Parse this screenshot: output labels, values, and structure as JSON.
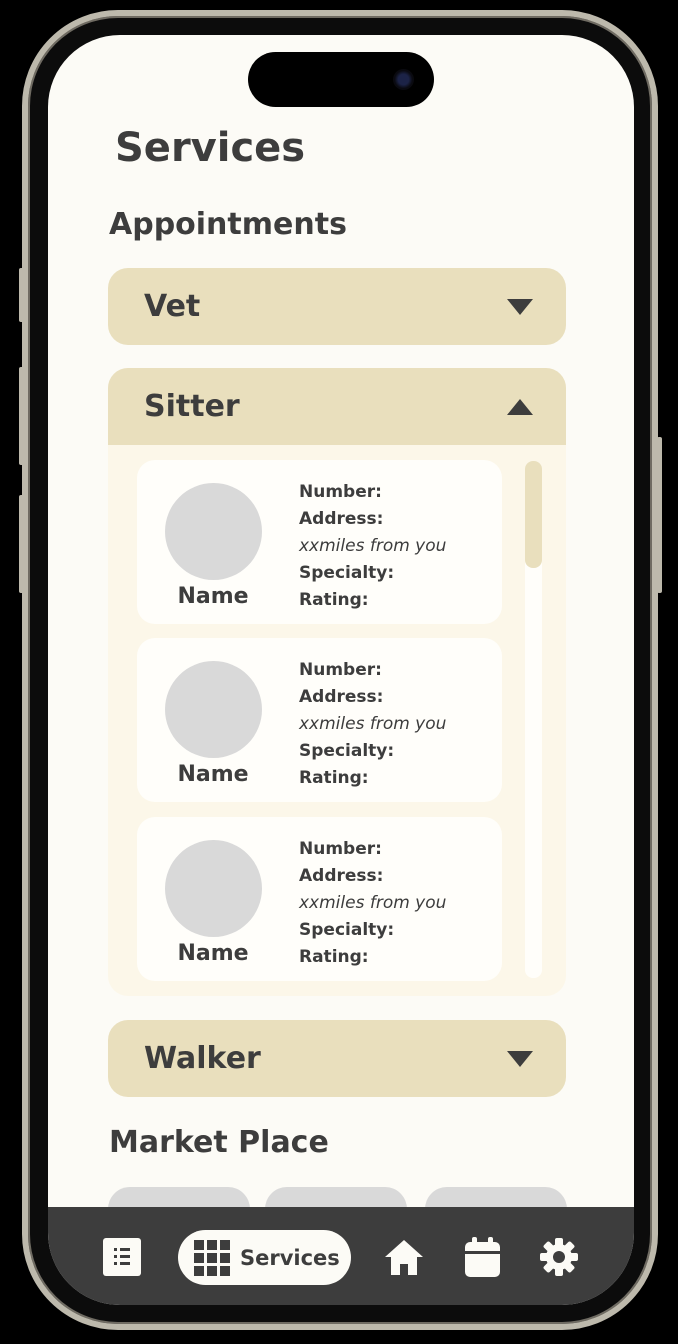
{
  "screen": {
    "title": "Services"
  },
  "appointments": {
    "heading": "Appointments",
    "categories": [
      {
        "label": "Vet",
        "expanded": false
      },
      {
        "label": "Sitter",
        "expanded": true
      },
      {
        "label": "Walker",
        "expanded": false
      }
    ]
  },
  "sitters": [
    {
      "name": "Name",
      "number_label": "Number:",
      "address_label": "Address:",
      "distance": "xxmiles from you",
      "specialty_label": "Specialty:",
      "rating_label": "Rating:"
    },
    {
      "name": "Name",
      "number_label": "Number:",
      "address_label": "Address:",
      "distance": "xxmiles from you",
      "specialty_label": "Specialty:",
      "rating_label": "Rating:"
    },
    {
      "name": "Name",
      "number_label": "Number:",
      "address_label": "Address:",
      "distance": "xxmiles from you",
      "specialty_label": "Specialty:",
      "rating_label": "Rating:"
    }
  ],
  "marketplace": {
    "heading": "Market Place"
  },
  "nav": {
    "items": [
      {
        "icon": "list-icon",
        "active": false
      },
      {
        "icon": "grid-icon",
        "label": "Services",
        "active": true
      },
      {
        "icon": "home-icon",
        "active": false
      },
      {
        "icon": "calendar-icon",
        "active": false
      },
      {
        "icon": "gear-icon",
        "active": false
      }
    ]
  },
  "colors": {
    "background": "#fcfbf6",
    "accent": "#e9dfbd",
    "text": "#3d3d3d",
    "navbar": "#3d3d3d",
    "placeholder": "#d9d9d9"
  }
}
